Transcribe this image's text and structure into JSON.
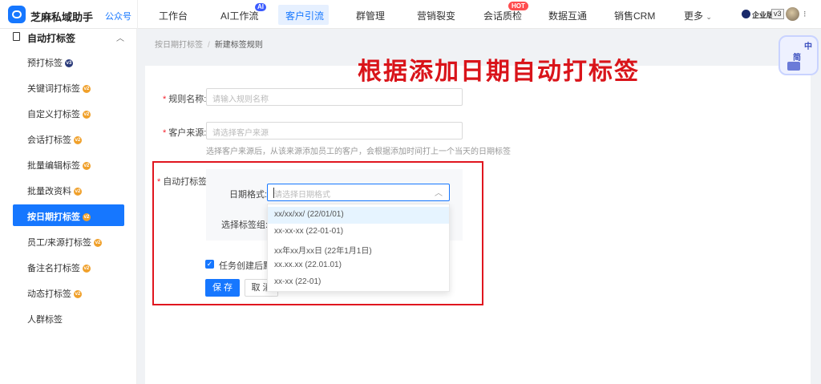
{
  "topbar": {
    "brand": "芝麻私域助手",
    "public_account": "公众号",
    "nav": [
      {
        "label": "工作台"
      },
      {
        "label": "AI工作流",
        "badge": "AI"
      },
      {
        "label": "客户引流",
        "active": true
      },
      {
        "label": "群管理"
      },
      {
        "label": "营销裂变"
      },
      {
        "label": "会话质检",
        "badge": "HOT"
      },
      {
        "label": "数据互通"
      },
      {
        "label": "销售CRM"
      },
      {
        "label": "更多"
      }
    ],
    "edition": "企业版",
    "version": "v3"
  },
  "sidebar": {
    "section_title": "自动打标签",
    "items": [
      {
        "label": "预打标签",
        "badge": "v3"
      },
      {
        "label": "关键词打标签",
        "badge": "v2"
      },
      {
        "label": "自定义打标签",
        "badge": "v2"
      },
      {
        "label": "会话打标签",
        "badge": "v2"
      },
      {
        "label": "批量编辑标签",
        "badge": "v2"
      },
      {
        "label": "批量改资料",
        "badge": "v2"
      },
      {
        "label": "按日期打标签",
        "badge": "v2",
        "active": true
      },
      {
        "label": "员工/来源打标签",
        "badge": "v2"
      },
      {
        "label": "备注名打标签",
        "badge": "v2"
      },
      {
        "label": "动态打标签",
        "badge": "v2"
      },
      {
        "label": "人群标签",
        "badge": ""
      }
    ]
  },
  "breadcrumb": {
    "parent": "按日期打标签",
    "separator": "/",
    "current": "新建标签规则"
  },
  "annotation": "根据添加日期自动打标签",
  "form": {
    "rule_name": {
      "label": "规则名称:",
      "placeholder": "请输入规则名称"
    },
    "customer_source": {
      "label": "客户来源:",
      "placeholder": "请选择客户来源",
      "hint": "选择客户来源后，从该来源添加员工的客户，会根据添加时间打上一个当天的日期标签"
    },
    "auto_tag": {
      "label": "自动打标签:",
      "date_format_label": "日期格式:",
      "date_format_placeholder": "请选择日期格式",
      "tag_group_label": "选择标签组:",
      "date_format_options": [
        "xx/xx/xx/ (22/01/01)",
        "xx-xx-xx (22-01-01)",
        "xx年xx月xx日 (22年1月1日)",
        "xx.xx.xx (22.01.01)",
        "xx-xx (22-01)"
      ]
    },
    "checkbox_label": "任务创建后默认",
    "save": "保 存",
    "cancel": "取 消"
  },
  "float_badge": {
    "line1": "中",
    "line2": "简"
  },
  "colors": {
    "accent": "#1677ff",
    "annotation_red": "#d9141a",
    "hot": "#ff4d4f"
  }
}
